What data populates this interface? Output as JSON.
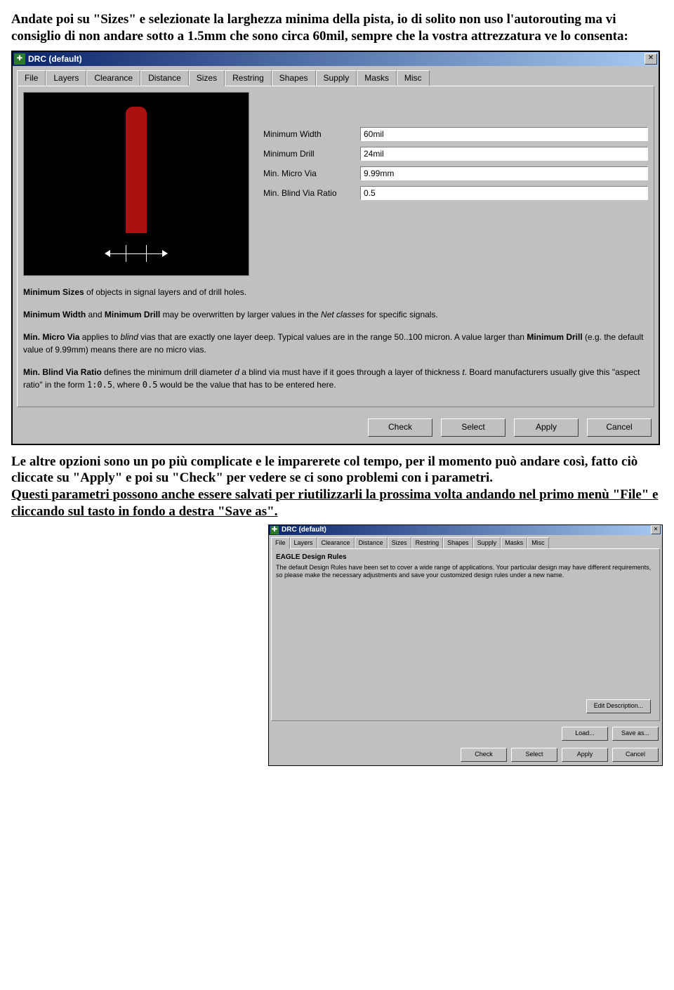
{
  "intro": {
    "line1": "Andate poi su \"Sizes\" e selezionate la larghezza minima della pista, io di solito non uso l'autorouting ma vi consiglio di non andare sotto a 1.5mm che sono circa 60mil, sempre che la vostra attrezzatura ve lo consenta:"
  },
  "window1": {
    "title": "DRC (default)",
    "tabs": [
      "File",
      "Layers",
      "Clearance",
      "Distance",
      "Sizes",
      "Restring",
      "Shapes",
      "Supply",
      "Masks",
      "Misc"
    ],
    "activeTab": 4,
    "fields": {
      "minWidth": {
        "label": "Minimum Width",
        "value": "60mil"
      },
      "minDrill": {
        "label": "Minimum Drill",
        "value": "24mil"
      },
      "minMicroVia": {
        "label": "Min. Micro Via",
        "value": "9.99mm"
      },
      "minBlindRatio": {
        "label": "Min. Blind Via Ratio",
        "value": "0.5"
      }
    },
    "descHtml": {
      "p1a": "Minimum Sizes",
      "p1b": " of objects in signal layers and of drill holes.",
      "p2a": "Minimum Width",
      "p2b": " and ",
      "p2c": "Minimum Drill",
      "p2d": " may be overwritten by larger values in the ",
      "p2e": "Net classes",
      "p2f": " for specific signals.",
      "p3a": "Min. Micro Via",
      "p3b": " applies to ",
      "p3c": "blind",
      "p3d": " vias that are exactly one layer deep. Typical values are in the range 50..100 micron. A value larger than ",
      "p3e": "Minimum Drill",
      "p3f": " (e.g. the default value of 9.99mm) means there are no micro vias.",
      "p4a": "Min. Blind Via Ratio",
      "p4b": " defines the minimum drill diameter ",
      "p4c": "d",
      "p4d": " a blind via must have if it goes through a layer of thickness ",
      "p4e": "t",
      "p4f": ". Board manufacturers usually give this \"aspect ratio\" in the form ",
      "p4g": "1:0.5",
      "p4h": ", where ",
      "p4i": "0.5",
      "p4j": " would be the value that has to be entered here."
    },
    "buttons": {
      "check": "Check",
      "select": "Select",
      "apply": "Apply",
      "cancel": "Cancel"
    }
  },
  "mid": {
    "p1": "Le altre opzioni sono un po più complicate e le imparerete col tempo, per il momento può andare così, fatto ciò cliccate su \"Apply\" e poi su \"Check\" per vedere se ci sono problemi con i parametri.",
    "p2": "Questi parametri possono anche essere salvati per riutilizzarli la prossima volta andando nel primo menù \"File\" e cliccando sul tasto in fondo a destra \"Save as\"."
  },
  "window2": {
    "title": "DRC (default)",
    "tabs": [
      "File",
      "Layers",
      "Clearance",
      "Distance",
      "Sizes",
      "Restring",
      "Shapes",
      "Supply",
      "Masks",
      "Misc"
    ],
    "activeTab": 0,
    "heading": "EAGLE Design Rules",
    "text": "The default Design Rules have been set to cover a wide range of applications. Your particular design may have different requirements, so please make the necessary adjustments and save your customized design rules under a new name.",
    "editDescription": "Edit Description...",
    "load": "Load...",
    "saveAs": "Save as...",
    "buttons": {
      "check": "Check",
      "select": "Select",
      "apply": "Apply",
      "cancel": "Cancel"
    }
  }
}
